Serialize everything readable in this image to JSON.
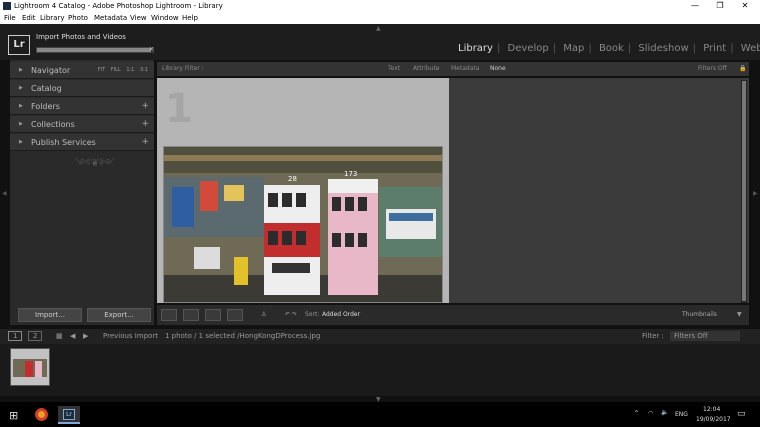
{
  "window": {
    "title": "Lightroom 4 Catalog - Adobe Photoshop Lightroom - Library",
    "controls": {
      "minimize": "—",
      "maximize": "❐",
      "close": "✕"
    }
  },
  "menu": [
    "File",
    "Edit",
    "Library",
    "Photo",
    "Metadata",
    "View",
    "Window",
    "Help"
  ],
  "identity": {
    "logo": "Lr",
    "activity_title": "Import Photos and Videos",
    "progress": 0.98,
    "cancel": "×"
  },
  "modules": [
    "Library",
    "Develop",
    "Map",
    "Book",
    "Slideshow",
    "Print",
    "Web"
  ],
  "active_module": "Library",
  "left_panel": {
    "navigator": {
      "label": "Navigator",
      "options": [
        "FIT",
        "FILL",
        "1:1",
        "3:1"
      ]
    },
    "catalog": "Catalog",
    "folders": "Folders",
    "collections": "Collections",
    "publish_services": "Publish Services",
    "plus": "+",
    "ornament": "༺❦༻"
  },
  "filter_bar": {
    "label": "Library Filter :",
    "options": [
      "Text",
      "Attribute",
      "Metadata",
      "None"
    ],
    "active": "None",
    "preset": "Filters Off",
    "lock": "🔒"
  },
  "grid": {
    "cell_number": "1",
    "photo": {
      "tram_left_number": "28",
      "tram_right_number": "173"
    }
  },
  "buttons": {
    "import": "Import...",
    "export": "Export..."
  },
  "toolbar": {
    "sort_label": "Sort:",
    "sort_value": "Added Order",
    "thumbnails_label": "Thumbnails",
    "menu_arrow": "▼"
  },
  "filmstrip_bar": {
    "monitor1": "1",
    "monitor2": "2",
    "source": "Previous Import",
    "status": "1 photo / 1 selected /HongKongDProcess.jpg",
    "filter_label": "Filter :",
    "filter_value": "Filters Off"
  },
  "taskbar": {
    "lang": "ENG",
    "time": "12:04",
    "date": "19/09/2017",
    "app": "Lr"
  },
  "colors": {
    "panel_bg": "#2a2a2a",
    "grid_bg": "#3b3b3b",
    "selected_cell": "#b5b5b5",
    "module_active": "#dddddd",
    "taskbar": "#000000"
  }
}
